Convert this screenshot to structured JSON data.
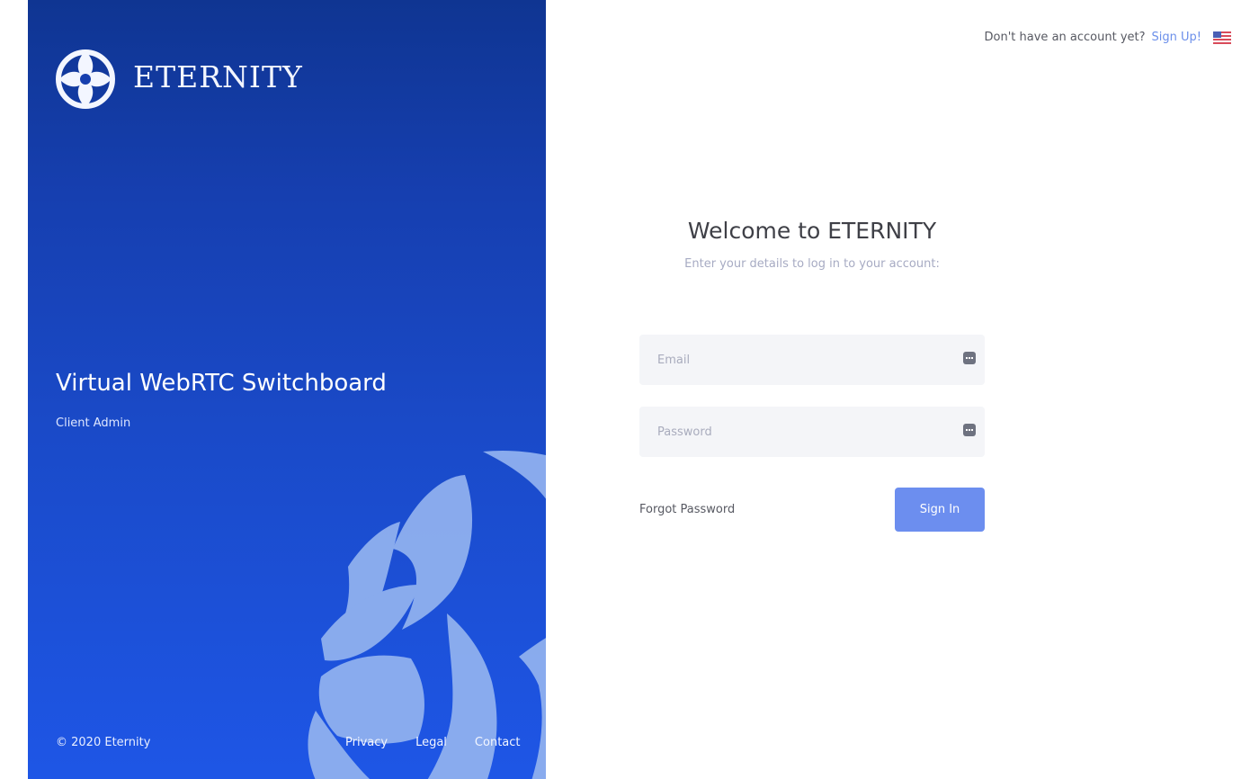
{
  "brand": {
    "name": "ETERNITY",
    "logo_icon": "eternity-knot-icon"
  },
  "hero": {
    "title": "Virtual WebRTC Switchboard",
    "subtitle": "Client Admin"
  },
  "footer": {
    "copyright": "© 2020 Eternity",
    "links": [
      "Privacy",
      "Legal",
      "Contact"
    ]
  },
  "topbar": {
    "question": "Don't have an account yet?",
    "signup_label": "Sign Up!",
    "language_icon": "us-flag-icon"
  },
  "login": {
    "title": "Welcome to ETERNITY",
    "subtitle": "Enter your details to log in to your account:",
    "email_placeholder": "Email",
    "email_value": "",
    "password_placeholder": "Password",
    "password_value": "",
    "forgot_label": "Forgot Password",
    "signin_label": "Sign In"
  },
  "colors": {
    "panel_top": "#0f3592",
    "panel_bottom": "#1e56e6",
    "accent": "#6c8eef",
    "link": "#6b8fea",
    "title_text": "#3f4047",
    "input_bg": "#f4f5f8"
  }
}
